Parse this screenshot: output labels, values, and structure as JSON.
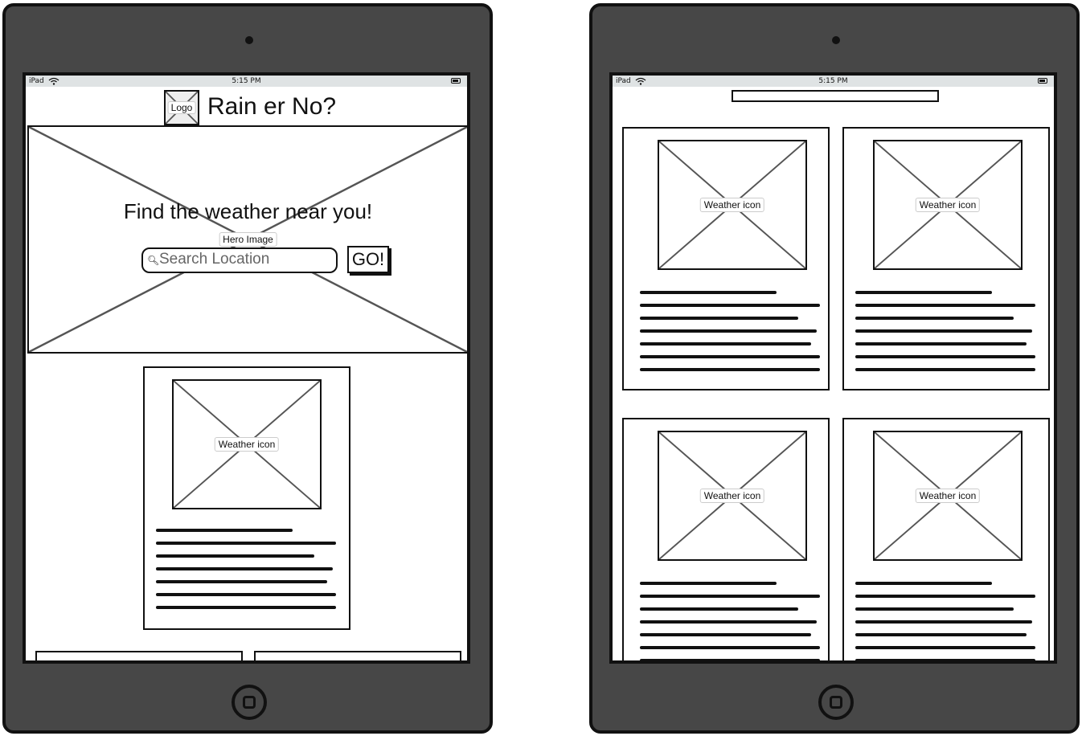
{
  "device": {
    "carrier": "iPad",
    "time": "5:15 PM"
  },
  "left_screen": {
    "logo_label": "Logo",
    "site_title": "Rain er No?",
    "hero": {
      "heading": "Find the weather near you!",
      "image_label": "Hero Image",
      "search_placeholder": "Search Location",
      "go_label": "GO!"
    },
    "weather_card": {
      "icon_label": "Weather icon"
    }
  },
  "right_screen": {
    "cards": [
      {
        "icon_label": "Weather icon"
      },
      {
        "icon_label": "Weather icon"
      },
      {
        "icon_label": "Weather icon"
      },
      {
        "icon_label": "Weather icon"
      }
    ]
  }
}
